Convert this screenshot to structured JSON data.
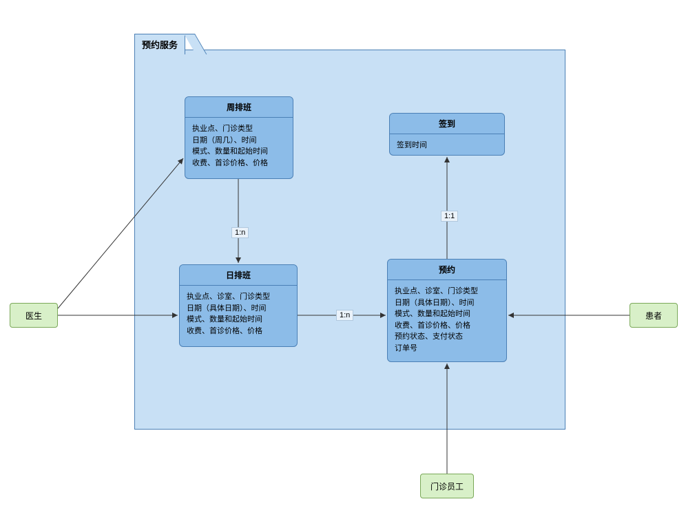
{
  "package": {
    "title": "预约服务"
  },
  "actors": {
    "doctor": {
      "label": "医生"
    },
    "patient": {
      "label": "患者"
    },
    "clinicStaff": {
      "label": "门诊员工"
    }
  },
  "entities": {
    "weeklySchedule": {
      "title": "周排班",
      "lines": [
        "执业点、门诊类型",
        "日期（周几）、时间",
        "模式、数量和起始时间",
        "收费、首诊价格、价格"
      ]
    },
    "dailySchedule": {
      "title": "日排班",
      "lines": [
        "执业点、诊室、门诊类型",
        "日期（具体日期）、时间",
        "模式、数量和起始时间",
        "收费、首诊价格、价格"
      ]
    },
    "checkIn": {
      "title": "签到",
      "lines": [
        "签到时间"
      ]
    },
    "appointment": {
      "title": "预约",
      "lines": [
        "执业点、诊室、门诊类型",
        "日期（具体日期）、时间",
        "模式、数量和起始时间",
        "收费、首诊价格、价格",
        "预约状态、支付状态",
        "订单号"
      ]
    }
  },
  "edgeLabels": {
    "weekly_to_daily": "1:n",
    "daily_to_appointment": "1:n",
    "appointment_to_checkin": "1:1"
  }
}
